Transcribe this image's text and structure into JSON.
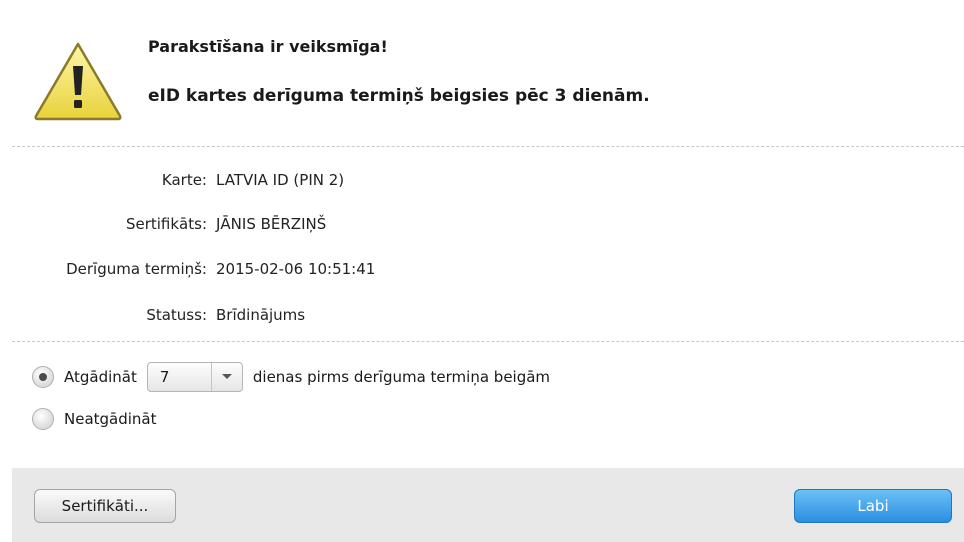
{
  "header": {
    "title": "Parakstīšana ir veiksmīga!",
    "message": "eID kartes derīguma termiņš beigsies pēc 3 dienām.",
    "icon": "warning-icon"
  },
  "info": [
    {
      "label": "Karte:",
      "value": "LATVIA ID (PIN 2)"
    },
    {
      "label": "Sertifikāts:",
      "value": "JĀNIS BĒRZIŅŠ"
    },
    {
      "label": "Derīguma termiņš:",
      "value": "2015-02-06 10:51:41"
    },
    {
      "label": "Statuss:",
      "value": "Brīdinājums"
    }
  ],
  "reminder": {
    "remind_label": "Atgādināt",
    "days_value": "7",
    "days_suffix": "dienas pirms derīguma termiņa beigām",
    "no_remind_label": "Neatgādināt",
    "selected": "remind"
  },
  "footer": {
    "certificates_button": "Sertifikāti...",
    "ok_button": "Labi"
  },
  "colors": {
    "accent": "#2a8fe0",
    "warning": "#f5e66a"
  }
}
